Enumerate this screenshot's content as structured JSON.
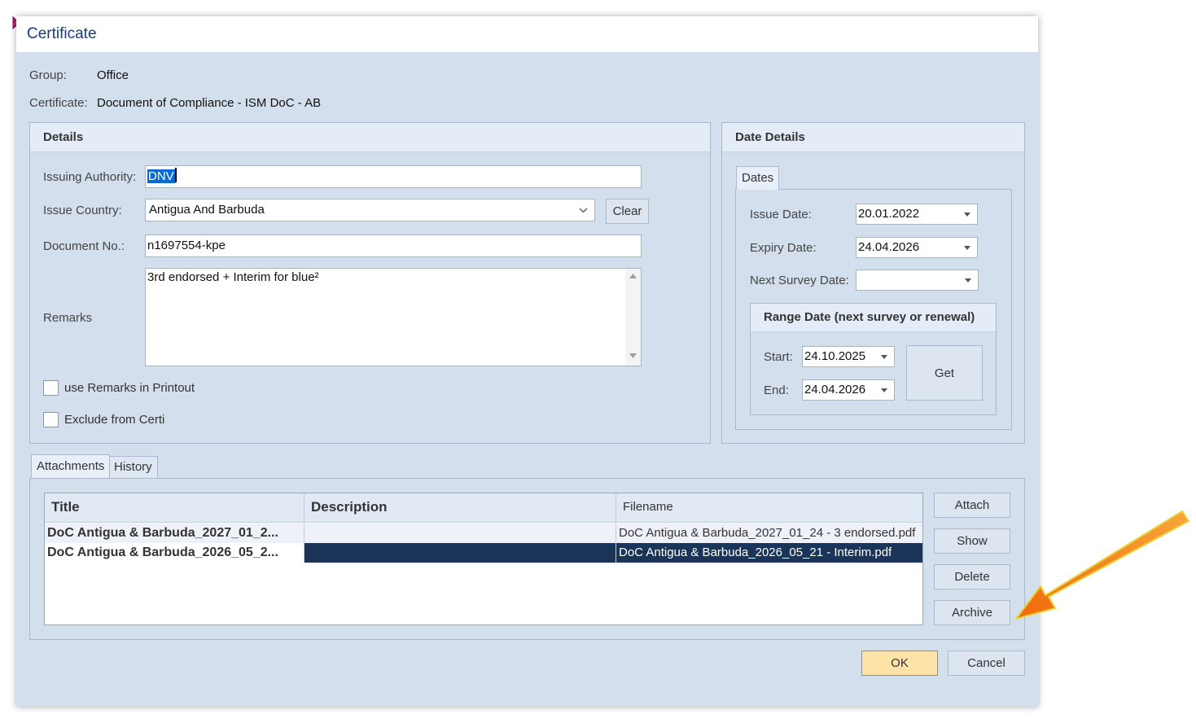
{
  "dialog": {
    "title": "Certificate"
  },
  "header": {
    "group_label": "Group:",
    "group_value": "Office",
    "certificate_label": "Certificate:",
    "certificate_value": "Document of Compliance - ISM DoC - AB"
  },
  "details": {
    "title": "Details",
    "issuing_authority_label": "Issuing Authority:",
    "issuing_authority_value": "DNV",
    "issue_country_label": "Issue Country:",
    "issue_country_value": "Antigua And Barbuda",
    "clear_label": "Clear",
    "document_no_label": "Document No.:",
    "document_no_value": "n1697554-kpe",
    "remarks_label": "Remarks",
    "remarks_value": "3rd endorsed + Interim for blue²",
    "use_remarks_label": "use Remarks in Printout",
    "exclude_label": "Exclude from Certi",
    "use_remarks_checked": false,
    "exclude_checked": false
  },
  "date_details": {
    "title": "Date Details",
    "tab_label": "Dates",
    "issue_date_label": "Issue Date:",
    "issue_date_value": "20.01.2022",
    "expiry_date_label": "Expiry Date:",
    "expiry_date_value": "24.04.2026",
    "next_survey_label": "Next Survey Date:",
    "next_survey_value": "",
    "range": {
      "title": "Range Date (next survey or renewal)",
      "start_label": "Start:",
      "start_value": "24.10.2025",
      "end_label": "End:",
      "end_value": "24.04.2026",
      "get_label": "Get"
    }
  },
  "attachments": {
    "tabs": [
      {
        "label": "Attachments",
        "active": true
      },
      {
        "label": "History",
        "active": false
      }
    ],
    "columns": {
      "title": "Title",
      "description": "Description",
      "filename": "Filename"
    },
    "rows": [
      {
        "title": "DoC Antigua & Barbuda_2027_01_2...",
        "description": "",
        "filename": "DoC Antigua & Barbuda_2027_01_24 - 3 endorsed.pdf",
        "selected": false
      },
      {
        "title": "DoC Antigua & Barbuda_2026_05_2...",
        "description": "",
        "filename": "DoC Antigua & Barbuda_2026_05_21 - Interim.pdf",
        "selected": true
      }
    ],
    "buttons": {
      "attach": "Attach",
      "show": "Show",
      "delete": "Delete",
      "archive": "Archive"
    }
  },
  "footer": {
    "ok_label": "OK",
    "cancel_label": "Cancel"
  },
  "colors": {
    "dialog_bg": "#d4dfee",
    "title_text": "#1b3b78",
    "selected_row": "#1a3557",
    "ok_button": "#fde3a8",
    "arrow": "#f5820f",
    "text_selection": "#0b6ad1"
  },
  "icons": {
    "cursor": "mouse-pointer-icon",
    "dropdown": "chevron-down-icon",
    "annotation": "arrow-icon"
  }
}
